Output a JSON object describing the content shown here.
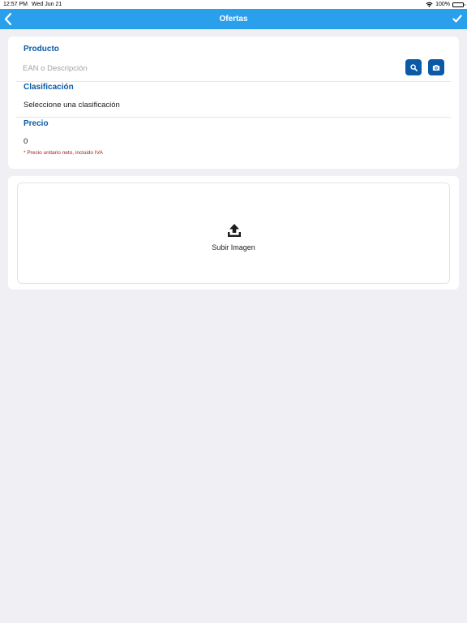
{
  "status_bar": {
    "time": "12:57 PM",
    "date": "Wed Jun 21",
    "battery": "100%"
  },
  "nav": {
    "title": "Ofertas",
    "back_icon": "chevron-left-icon",
    "confirm_icon": "checkmark-icon"
  },
  "form": {
    "product": {
      "label": "Producto",
      "placeholder": "EAN o Descripción",
      "value": ""
    },
    "classification": {
      "label": "Clasificación",
      "value": "Seleccione una clasificación"
    },
    "price": {
      "label": "Precio",
      "value": "0",
      "note": "* Precio unitario neto, incluido IVA"
    }
  },
  "upload": {
    "label": "Subir Imagen"
  },
  "colors": {
    "nav_background": "#2aa0ec",
    "accent": "#0a5aa6",
    "note": "#a12020",
    "page_background": "#efeff4"
  }
}
